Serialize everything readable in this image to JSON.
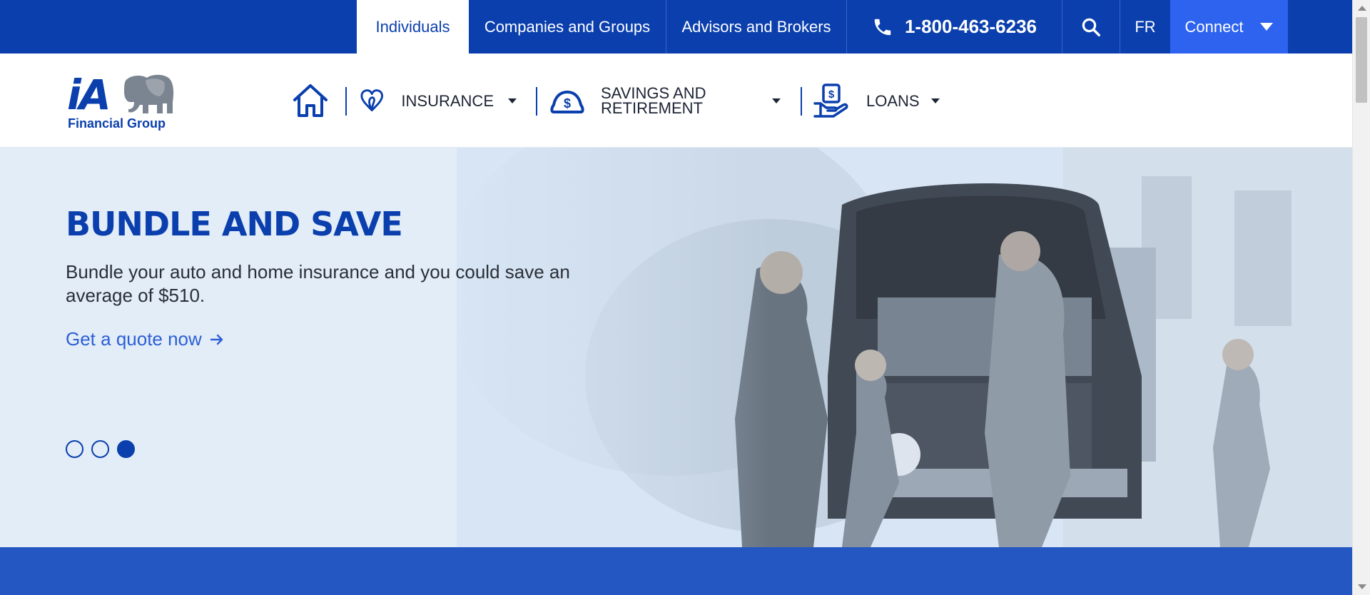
{
  "topbar": {
    "tabs": [
      {
        "label": "Individuals",
        "active": true
      },
      {
        "label": "Companies and Groups",
        "active": false
      },
      {
        "label": "Advisors and Brokers",
        "active": false
      }
    ],
    "phone": "1-800-463-6236",
    "language": "FR",
    "connect_label": "Connect"
  },
  "header": {
    "logo": {
      "mark": "iA",
      "subtitle": "Financial Group"
    },
    "nav": {
      "insurance": "INSURANCE",
      "savings_line1": "SAVINGS AND",
      "savings_line2": "RETIREMENT",
      "loans": "LOANS"
    }
  },
  "hero": {
    "title": "BUNDLE AND SAVE",
    "body": "Bundle your auto and home insurance and you could save an average of $510.",
    "cta": "Get a quote now",
    "slides": {
      "count": 3,
      "active_index": 2
    }
  },
  "colors": {
    "brand": "#0a3fad",
    "accent": "#2d63ef",
    "hero_bg": "#e2edf8",
    "link": "#2d5fd6"
  },
  "icons": [
    "phone-icon",
    "search-icon",
    "home-icon",
    "heart-icon",
    "money-bag-icon",
    "hand-money-icon",
    "arrow-right-icon",
    "elephant-logo-icon"
  ]
}
